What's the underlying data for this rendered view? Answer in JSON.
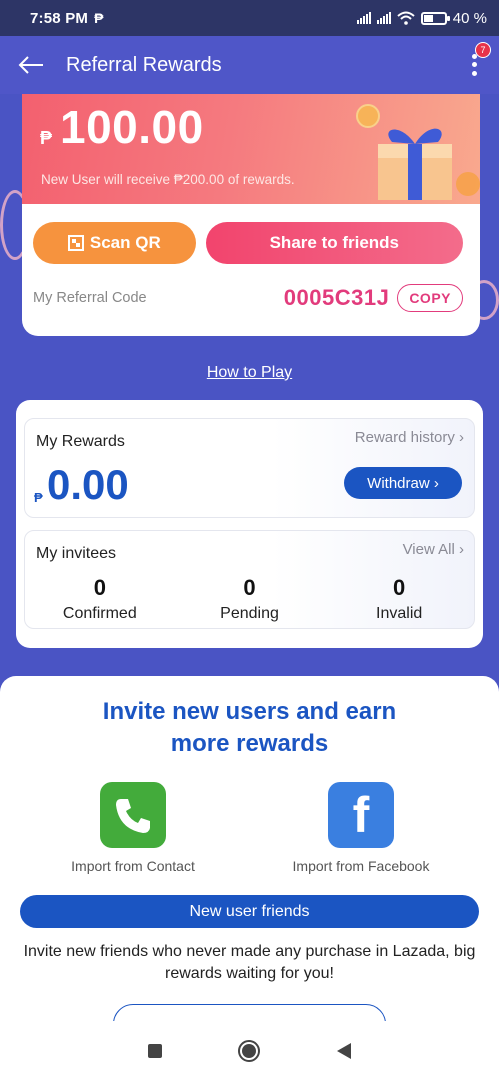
{
  "status_bar": {
    "time": "7:58 PM",
    "carrier_icon": "₱",
    "battery": "40 %",
    "battery_level": 0.4
  },
  "app_bar": {
    "title": "Referral Rewards",
    "badge": "7"
  },
  "referral": {
    "currency": "₱",
    "amount": "100.00",
    "subtitle": "New User will receive ₱200.00 of rewards.",
    "scan_label": "Scan QR",
    "share_label": "Share to friends",
    "code_label": "My Referral Code",
    "code": "0005C31J",
    "copy_label": "COPY"
  },
  "how_to_play": "How to Play",
  "rewards": {
    "label": "My Rewards",
    "history_link": "Reward history ›",
    "currency": "₱",
    "amount": "0.00",
    "withdraw_label": "Withdraw ›"
  },
  "invitees": {
    "label": "My invitees",
    "view_all": "View All ›",
    "stats": [
      {
        "value": "0",
        "label": "Confirmed"
      },
      {
        "value": "0",
        "label": "Pending"
      },
      {
        "value": "0",
        "label": "Invalid"
      }
    ]
  },
  "invite_panel": {
    "title_line1": "Invite new users and earn",
    "title_line2": "more rewards",
    "import_contact": "Import from Contact",
    "import_facebook": "Import from Facebook",
    "fb_glyph": "f",
    "new_user_button": "New user friends",
    "description": "Invite new friends who never made any purchase in Lazada, big rewards waiting for you!"
  },
  "colors": {
    "primary_blue": "#1b55c2",
    "pink": "#e23b7c",
    "orange": "#f6933e",
    "header": "#4f56c8"
  }
}
